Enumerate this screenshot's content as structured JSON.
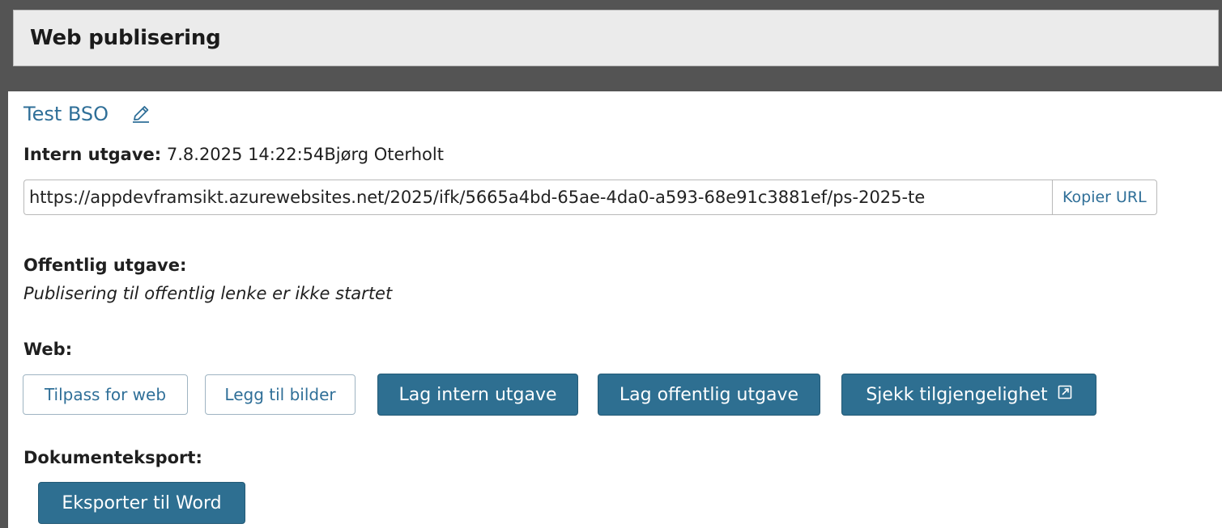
{
  "header": {
    "title": "Web publisering"
  },
  "document": {
    "title": "Test BSO",
    "edit_icon": "pencil-icon"
  },
  "internal_edition": {
    "label": "Intern utgave:",
    "timestamp": "7.8.2025 14:22:54",
    "author": "Bjørg Oterholt",
    "url": "https://appdevframsikt.azurewebsites.net/2025/ifk/5665a4bd-65ae-4da0-a593-68e91c3881ef/ps-2025-te",
    "copy_button_label": "Kopier URL"
  },
  "public_edition": {
    "label": "Offentlig utgave:",
    "status_note": "Publisering til offentlig lenke er ikke startet"
  },
  "web": {
    "label": "Web:",
    "buttons": [
      {
        "label": "Tilpass for web",
        "style": "outline"
      },
      {
        "label": "Legg til bilder",
        "style": "outline"
      },
      {
        "label": "Lag intern utgave",
        "style": "primary"
      },
      {
        "label": "Lag offentlig utgave",
        "style": "primary"
      },
      {
        "label": "Sjekk tilgjengelighet",
        "style": "primary",
        "icon": "external-link-icon"
      }
    ]
  },
  "document_export": {
    "label": "Dokumenteksport:",
    "button_label": "Eksporter til Word"
  },
  "colors": {
    "accent": "#2e6f91",
    "link": "#2f6f98",
    "frame_background": "#545454",
    "header_background": "#ebebeb"
  }
}
